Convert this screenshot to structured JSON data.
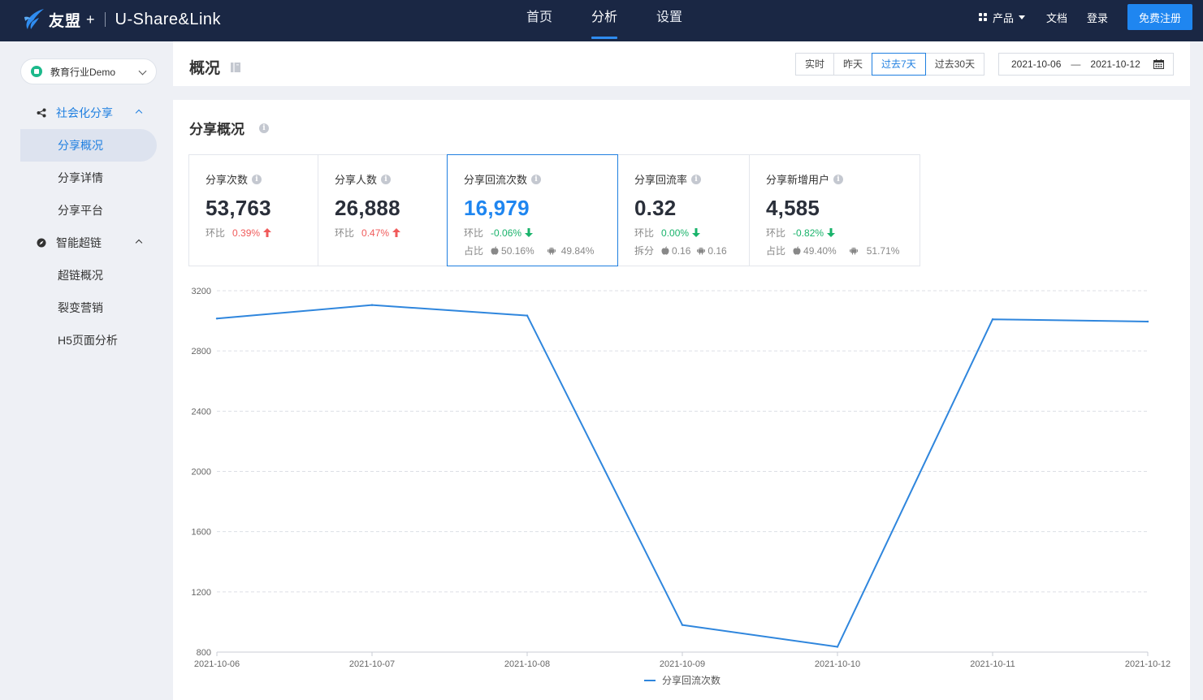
{
  "topnav": {
    "logo_text": "友盟",
    "logo_plus": "+",
    "logo_sub": "U-Share&Link",
    "tabs": [
      {
        "label": "首页",
        "active": false
      },
      {
        "label": "分析",
        "active": true
      },
      {
        "label": "设置",
        "active": false
      }
    ],
    "products_label": "产品",
    "docs_label": "文档",
    "login_label": "登录",
    "register_label": "免费注册",
    "colors": {
      "bg": "#1a2744",
      "accent": "#1f86f0"
    }
  },
  "sidebar": {
    "app_select": "教育行业Demo",
    "groups": [
      {
        "label": "社会化分享",
        "icon": "share-icon",
        "expanded": true,
        "active": true,
        "items": [
          {
            "label": "分享概况",
            "active": true
          },
          {
            "label": "分享详情",
            "active": false
          },
          {
            "label": "分享平台",
            "active": false
          }
        ]
      },
      {
        "label": "智能超链",
        "icon": "compass-icon",
        "expanded": true,
        "active": false,
        "items": [
          {
            "label": "超链概况",
            "active": false
          },
          {
            "label": "裂变营销",
            "active": false
          },
          {
            "label": "H5页面分析",
            "active": false
          }
        ]
      }
    ]
  },
  "header": {
    "title": "概况",
    "ranges": [
      {
        "label": "实时",
        "active": false
      },
      {
        "label": "昨天",
        "active": false
      },
      {
        "label": "过去7天",
        "active": true
      },
      {
        "label": "过去30天",
        "active": false
      }
    ],
    "date_start": "2021-10-06",
    "date_sep": "—",
    "date_end": "2021-10-12"
  },
  "overview": {
    "title": "分享概况",
    "info": "i",
    "cards": [
      {
        "label": "分享次数",
        "value": "53,763",
        "ratio_label": "环比",
        "change": "0.39%",
        "trend": "up"
      },
      {
        "label": "分享人数",
        "value": "26,888",
        "ratio_label": "环比",
        "change": "0.47%",
        "trend": "up"
      },
      {
        "label": "分享回流次数",
        "value": "16,979",
        "ratio_label": "环比",
        "change": "-0.06%",
        "trend": "down",
        "split_label": "占比",
        "ios": "50.16%",
        "android": "49.84%",
        "active": true
      },
      {
        "label": "分享回流率",
        "value": "0.32",
        "ratio_label": "环比",
        "change": "0.00%",
        "trend": "down",
        "split_label": "拆分",
        "ios": "0.16",
        "android": "0.16"
      },
      {
        "label": "分享新增用户",
        "value": "4,585",
        "ratio_label": "环比",
        "change": "-0.82%",
        "trend": "down",
        "split_label": "占比",
        "ios": "49.40%",
        "android": "51.71%"
      }
    ],
    "trend_colors": {
      "up": "#f05a5a",
      "down": "#19b36b"
    }
  },
  "chart_data": {
    "type": "line",
    "x": [
      "2021-10-06",
      "2021-10-07",
      "2021-10-08",
      "2021-10-09",
      "2021-10-10",
      "2021-10-11",
      "2021-10-12"
    ],
    "series": [
      {
        "name": "分享回流次数",
        "values": [
          3015,
          3105,
          3035,
          980,
          835,
          3010,
          2995
        ],
        "color": "#2f86dd"
      }
    ],
    "yticks": [
      800,
      1200,
      1600,
      2000,
      2400,
      2800,
      3200
    ],
    "ylim": [
      800,
      3200
    ],
    "grid": true,
    "legend": "bottom-center"
  }
}
